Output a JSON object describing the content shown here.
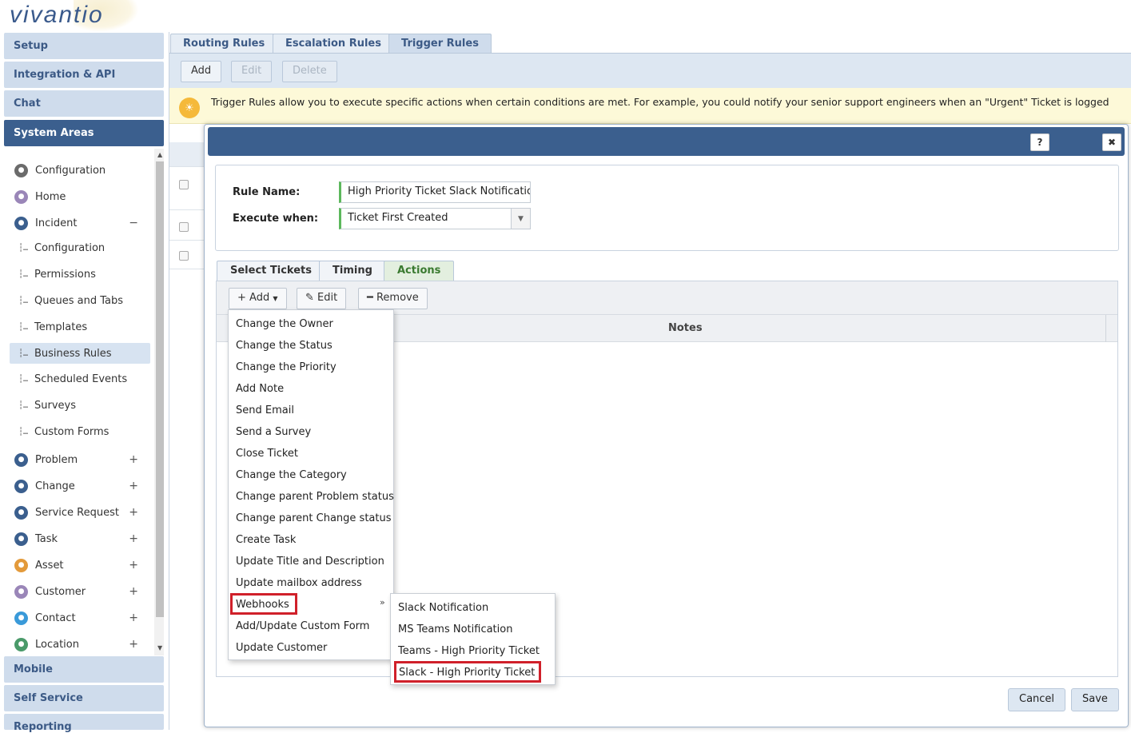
{
  "app": {
    "logo": "vivantio"
  },
  "sidebar": {
    "sections_top": [
      "Setup",
      "Integration & API",
      "Chat",
      "System Areas"
    ],
    "sections_bottom": [
      "Mobile",
      "Self Service",
      "Reporting"
    ],
    "tree": [
      {
        "label": "Configuration",
        "icon": "gear-icon",
        "color": "#6b6b6b",
        "level": 0,
        "expander": ""
      },
      {
        "label": "Home",
        "icon": "home-icon",
        "color": "#9a86b8",
        "level": 0,
        "expander": ""
      },
      {
        "label": "Incident",
        "icon": "incident-icon",
        "color": "#3b5f8e",
        "level": 0,
        "expander": "−"
      },
      {
        "label": "Configuration",
        "level": 1
      },
      {
        "label": "Permissions",
        "level": 1
      },
      {
        "label": "Queues and Tabs",
        "level": 1
      },
      {
        "label": "Templates",
        "level": 1
      },
      {
        "label": "Business Rules",
        "level": 1,
        "selected": true
      },
      {
        "label": "Scheduled Events",
        "level": 1
      },
      {
        "label": "Surveys",
        "level": 1
      },
      {
        "label": "Custom Forms",
        "level": 1
      },
      {
        "label": "Problem",
        "icon": "problem-icon",
        "color": "#3b5f8e",
        "level": 0,
        "expander": "+"
      },
      {
        "label": "Change",
        "icon": "change-icon",
        "color": "#3b5f8e",
        "level": 0,
        "expander": "+"
      },
      {
        "label": "Service Request",
        "icon": "service-request-icon",
        "color": "#3b5f8e",
        "level": 0,
        "expander": "+"
      },
      {
        "label": "Task",
        "icon": "task-icon",
        "color": "#3b5f8e",
        "level": 0,
        "expander": "+"
      },
      {
        "label": "Asset",
        "icon": "asset-icon",
        "color": "#e39a3b",
        "level": 0,
        "expander": "+"
      },
      {
        "label": "Customer",
        "icon": "customer-icon",
        "color": "#9a86b8",
        "level": 0,
        "expander": "+"
      },
      {
        "label": "Contact",
        "icon": "contact-icon",
        "color": "#3a9ad9",
        "level": 0,
        "expander": "+"
      },
      {
        "label": "Location",
        "icon": "location-icon",
        "color": "#4a9a6a",
        "level": 0,
        "expander": "+"
      }
    ]
  },
  "top_tabs": [
    "Routing Rules",
    "Escalation Rules",
    "Trigger Rules"
  ],
  "toolbar": {
    "add": "Add",
    "edit": "Edit",
    "delete": "Delete"
  },
  "info": "Trigger Rules allow you to execute specific actions when certain conditions are met. For example, you could notify your senior support engineers when an \"Urgent\" Ticket is logged",
  "dialog": {
    "help": "?",
    "close": "✖",
    "rule_name_label": "Rule Name:",
    "rule_name_value": "High Priority Ticket Slack Notification",
    "execute_label": "Execute when:",
    "execute_value": "Ticket First Created",
    "tabs": [
      "Select Tickets",
      "Timing",
      "Actions"
    ],
    "actions_toolbar": {
      "add": "Add",
      "edit": "Edit",
      "remove": "Remove"
    },
    "notes_header": "Notes",
    "cancel": "Cancel",
    "save": "Save"
  },
  "add_menu": [
    "Change the Owner",
    "Change the Status",
    "Change the Priority",
    "Add Note",
    "Send Email",
    "Send a Survey",
    "Close Ticket",
    "Change the Category",
    "Change parent Problem status",
    "Change parent Change status",
    "Create Task",
    "Update Title and Description",
    "Update mailbox address",
    "Webhooks",
    "Add/Update Custom Form",
    "Update Customer"
  ],
  "webhooks_menu": [
    "Slack Notification",
    "MS Teams Notification",
    "Teams - High Priority Ticket",
    "Slack - High Priority Ticket"
  ],
  "colors": {
    "brand": "#3b5f8e",
    "highlight": "#d0202a",
    "info_bg": "#fdf9d8",
    "actions_tab": "#3a7a30"
  }
}
